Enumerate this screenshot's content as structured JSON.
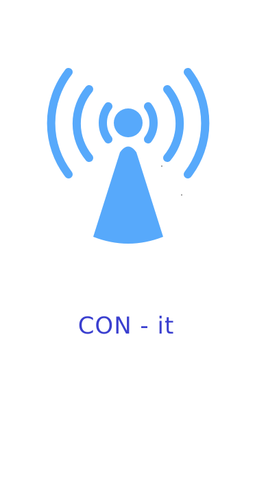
{
  "app": {
    "name": "CON - it"
  },
  "logo": {
    "icon": "wifi-broadcast-tower-icon",
    "color": "#57a9fb"
  },
  "text_color": "#3a3fcf"
}
